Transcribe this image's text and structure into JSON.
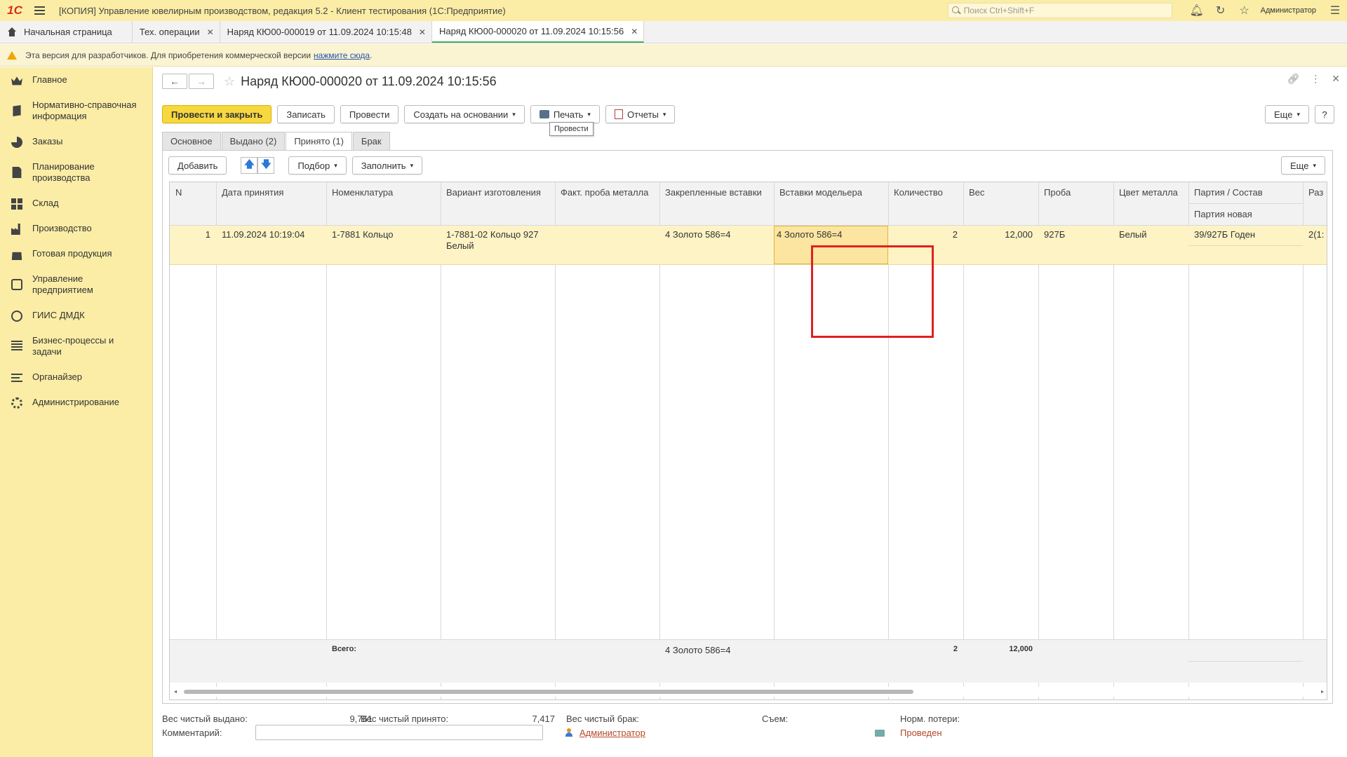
{
  "titlebar": {
    "logo": "1С",
    "app_title": "[КОПИЯ] Управление ювелирным производством, редакция 5.2  - Клиент тестирования (1С:Предприятие)",
    "search_placeholder": "Поиск Ctrl+Shift+F",
    "user": "Администратор"
  },
  "tabs": [
    {
      "label": "Начальная страница"
    },
    {
      "label": "Тех. операции"
    },
    {
      "label": "Наряд КЮ00-000019 от 11.09.2024 10:15:48"
    },
    {
      "label": "Наряд КЮ00-000020 от 11.09.2024 10:15:56"
    }
  ],
  "warning": {
    "text": "Эта версия для разработчиков. Для приобретения коммерческой версии",
    "link": "нажмите сюда",
    "tail": "."
  },
  "sidebar": {
    "items": [
      {
        "label": "Главное",
        "icon": "crown-icon"
      },
      {
        "label": "Нормативно-справочная информация",
        "icon": "book-icon"
      },
      {
        "label": "Заказы",
        "icon": "pie-icon"
      },
      {
        "label": "Планирование производства",
        "icon": "doc-icon"
      },
      {
        "label": "Склад",
        "icon": "grid-icon"
      },
      {
        "label": "Производство",
        "icon": "factory-icon"
      },
      {
        "label": "Готовая продукция",
        "icon": "bag-icon"
      },
      {
        "label": "Управление предприятием",
        "icon": "org-icon"
      },
      {
        "label": "ГИИС ДМДК",
        "icon": "dmdk-icon"
      },
      {
        "label": "Бизнес-процессы и задачи",
        "icon": "bp-icon"
      },
      {
        "label": "Органайзер",
        "icon": "organizer-icon"
      },
      {
        "label": "Администрирование",
        "icon": "gear-icon"
      }
    ]
  },
  "form": {
    "title": "Наряд КЮ00-000020 от 11.09.2024 10:15:56",
    "toolbar": {
      "post_close": "Провести и закрыть",
      "write": "Записать",
      "post": "Провести",
      "create_based": "Создать на основании",
      "print": "Печать",
      "reports": "Отчеты",
      "more": "Еще",
      "help": "?"
    },
    "tooltip": "Провести",
    "page_tabs": [
      "Основное",
      "Выдано (2)",
      "Принято (1)",
      "Брак"
    ],
    "table_toolbar": {
      "add": "Добавить",
      "pick": "Подбор",
      "fill": "Заполнить",
      "more": "Еще"
    },
    "columns": {
      "n": "N",
      "date": "Дата принятия",
      "nomenclature": "Номенклатура",
      "variant": "Вариант изготовления",
      "fact_probe": "Факт. проба металла",
      "fixed_inserts": "Закрепленные вставки",
      "model_inserts": "Вставки модельера",
      "qty": "Количество",
      "weight": "Вес",
      "probe": "Проба",
      "metal_color": "Цвет металла",
      "batch": "Партия / Состав",
      "batch_new": "Партия новая",
      "size": "Раз"
    },
    "rows": [
      {
        "n": "1",
        "date": "11.09.2024 10:19:04",
        "nomenclature": "1-7881 Кольцо",
        "variant": "1-7881-02 Кольцо 927 Белый",
        "fact_probe": "",
        "fixed_inserts": "4 Золото 586=4",
        "model_inserts": "4 Золото 586=4",
        "qty": "2",
        "weight": "12,000",
        "probe": "927Б",
        "metal_color": "Белый",
        "batch": "39/927Б Годен",
        "size": "2(1:"
      }
    ],
    "totals": {
      "label": "Всего:",
      "fixed_inserts": "4 Золото 586=4",
      "qty": "2",
      "weight": "12,000"
    },
    "bottom": {
      "net_issued_label": "Вес чистый выдано:",
      "net_issued": "9,761",
      "net_accepted_label": "Вес чистый принято:",
      "net_accepted": "7,417",
      "net_defect_label": "Вес чистый брак:",
      "removal_label": "Съем:",
      "norm_loss_label": "Норм. потери:",
      "comment_label": "Комментарий:",
      "comment_value": "",
      "author": "Администратор",
      "status": "Проведен"
    }
  }
}
